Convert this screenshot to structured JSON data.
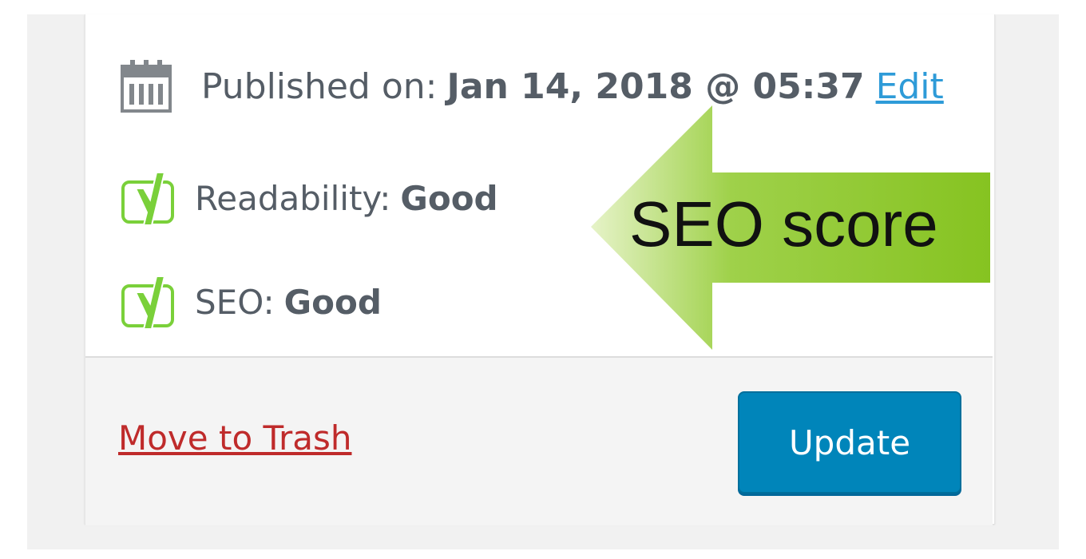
{
  "publish": {
    "label": "Published on:",
    "date": "Jan 14, 2018 @ 05:37",
    "edit_label": "Edit"
  },
  "readability": {
    "label": "Readability:",
    "value": "Good"
  },
  "seo": {
    "label": "SEO:",
    "value": "Good"
  },
  "actions": {
    "trash_label": "Move to Trash",
    "update_label": "Update"
  },
  "callout": {
    "text": "SEO score"
  },
  "colors": {
    "update_button": "#0085ba",
    "trash_link": "#bf2b2b",
    "edit_link": "#2e9bd8",
    "yoast_green": "#7ad03a",
    "arrow_green": "#8cc63f"
  },
  "icons": {
    "publish": "calendar-icon",
    "readability": "yoast-icon",
    "seo": "yoast-icon"
  }
}
